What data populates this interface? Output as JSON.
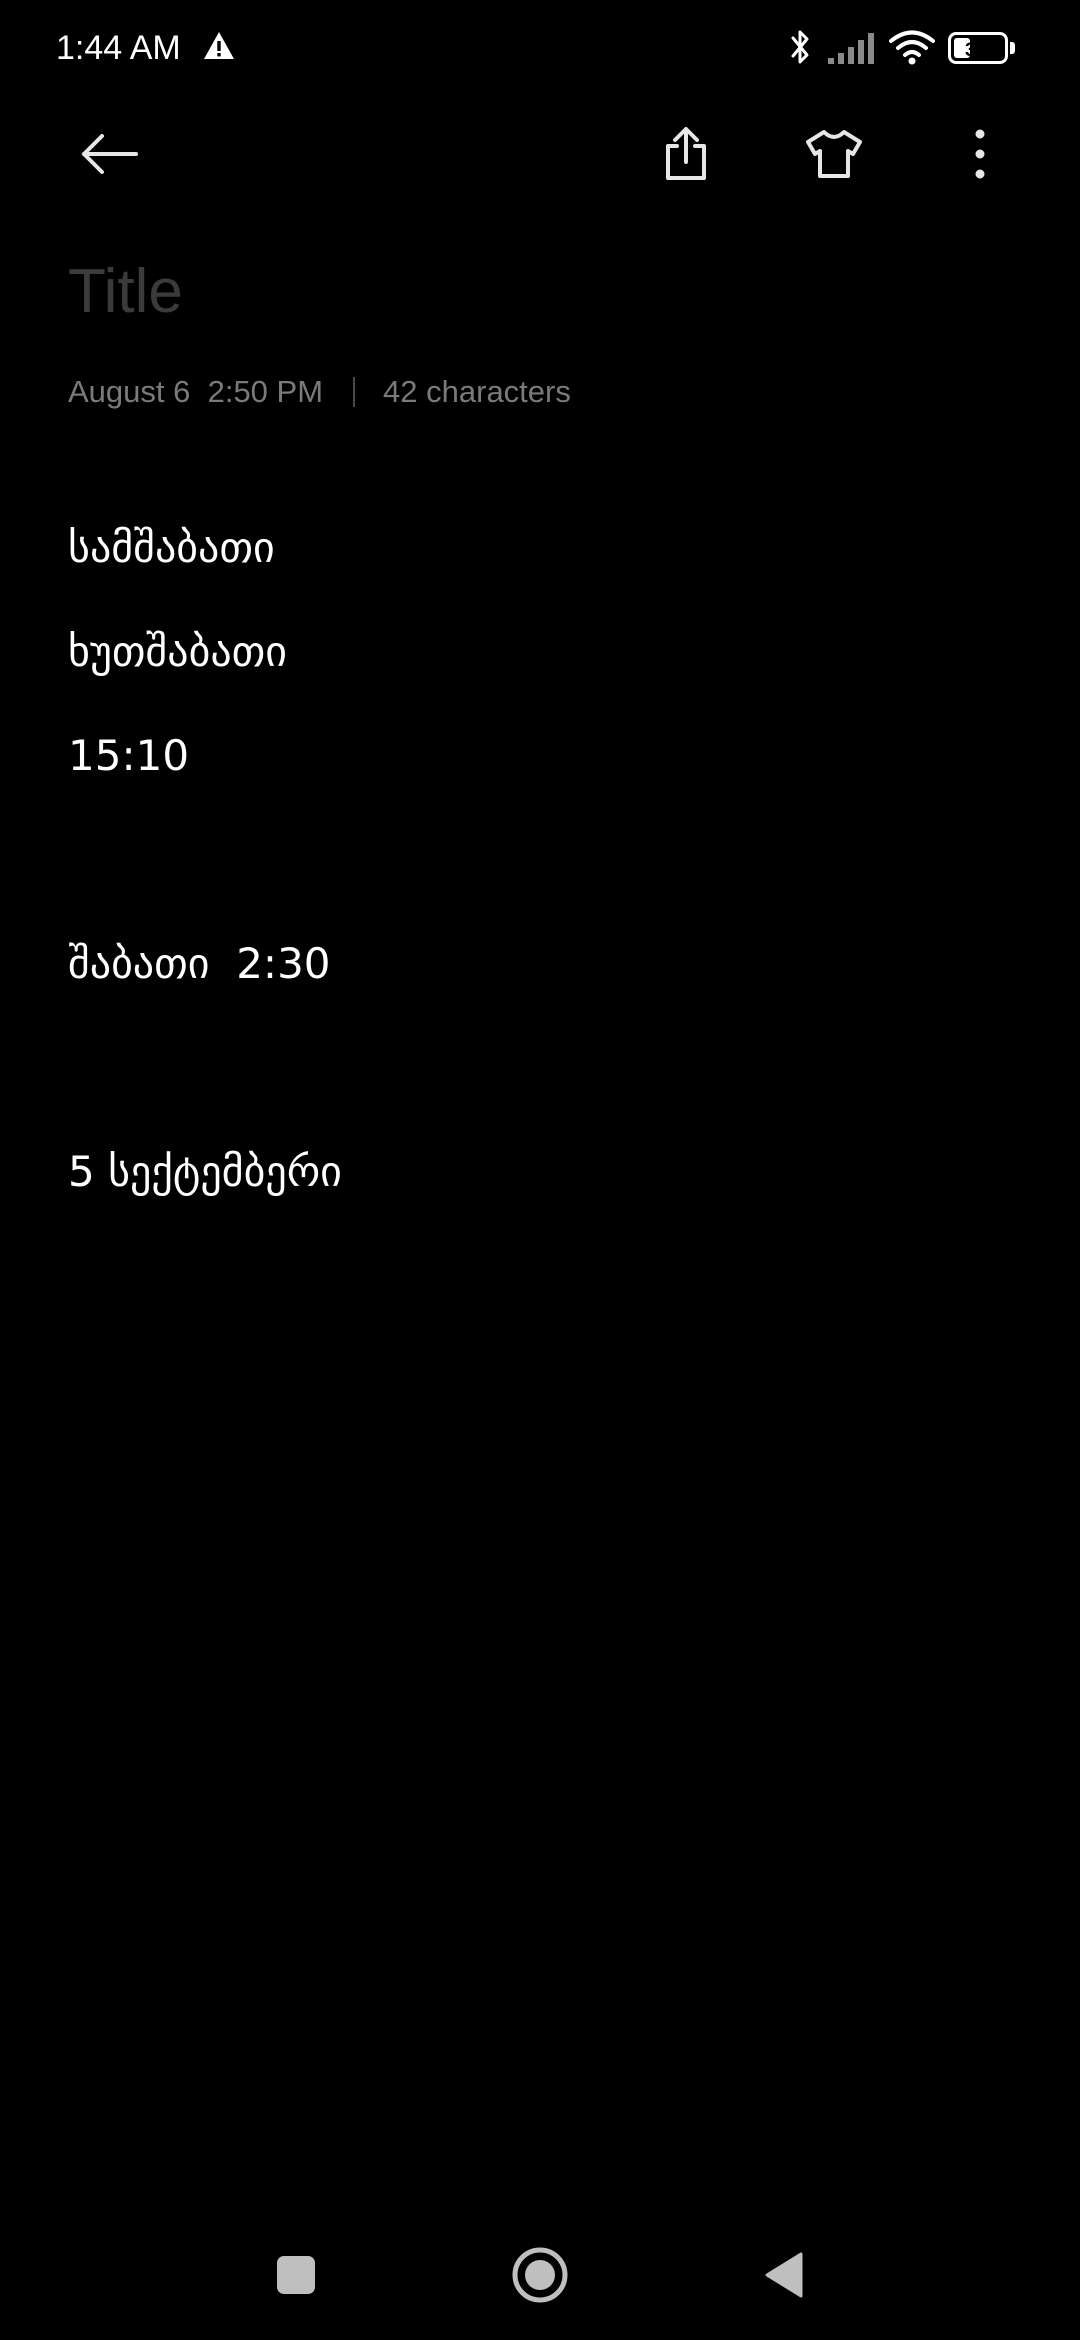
{
  "status_bar": {
    "time": "1:44 AM",
    "battery_level": "33",
    "battery_fraction": 0.33,
    "icons": [
      "alert-icon",
      "bluetooth-icon",
      "signal-icon",
      "wifi-icon",
      "battery-icon"
    ]
  },
  "toolbar": {
    "icons": [
      "back-arrow-icon",
      "share-icon",
      "tshirt-theme-icon",
      "more-vertical-icon"
    ]
  },
  "note": {
    "title_placeholder": "Title",
    "date": "August 6  2:50 PM",
    "char_count": "42 characters",
    "lines": [
      "სამშაბათი",
      "ხუთშაბათი",
      "15:10",
      "",
      "შაბათი  2:30",
      "",
      "5 სექტემბერი"
    ]
  },
  "nav_bar": {
    "icons": [
      "recents-square-icon",
      "home-circle-icon",
      "back-triangle-icon"
    ]
  },
  "colors": {
    "background": "#000000",
    "text": "#ffffff",
    "placeholder": "#3b3b3b",
    "meta": "#7a7a7a",
    "icons": "#e6e6e6",
    "nav_icons": "#bfbfbf"
  }
}
